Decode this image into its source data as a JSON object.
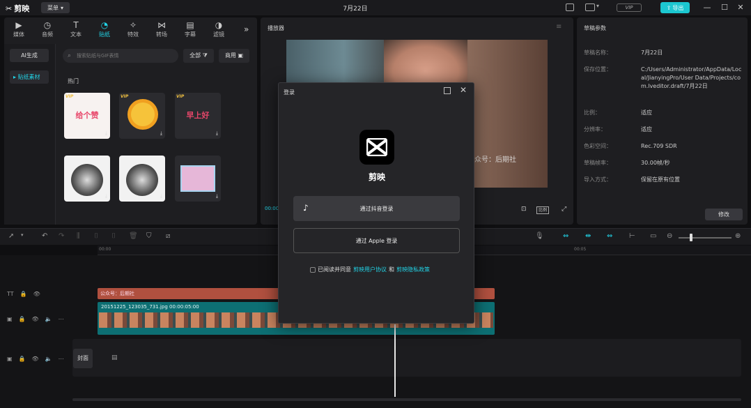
{
  "app": {
    "name": "剪映",
    "menu_label": "菜单",
    "title": "7月22日",
    "vip_label": "VIP",
    "export_label": "导出"
  },
  "tabs": [
    {
      "label": "媒体",
      "icon": "media-icon"
    },
    {
      "label": "音频",
      "icon": "audio-icon"
    },
    {
      "label": "文本",
      "icon": "text-icon"
    },
    {
      "label": "贴纸",
      "icon": "sticker-icon",
      "active": true
    },
    {
      "label": "特效",
      "icon": "effects-icon"
    },
    {
      "label": "转场",
      "icon": "transition-icon"
    },
    {
      "label": "字幕",
      "icon": "caption-icon"
    },
    {
      "label": "滤镜",
      "icon": "filter-icon"
    }
  ],
  "sticker_panel": {
    "ai_label": "AI生成",
    "category_label": "▸ 贴纸素材",
    "search_placeholder": "搜索贴纸与GIF表情",
    "filter_all": "全部",
    "filter_business": "商用",
    "section_title": "热门",
    "stickers": [
      {
        "text": "给个赞",
        "vip": "VIP"
      },
      {
        "text": "",
        "vip": "VIP"
      },
      {
        "text": "早上好",
        "vip": "VIP"
      },
      {
        "text": "",
        "vip": ""
      },
      {
        "text": "",
        "vip": ""
      },
      {
        "text": "",
        "vip": ""
      }
    ]
  },
  "player": {
    "title": "播放器",
    "watermark": "众号：后期社",
    "timecode": "00:00",
    "ratio_label": "比例"
  },
  "params": {
    "title": "草稿参数",
    "rows": [
      {
        "key": "草稿名称：",
        "value": "7月22日"
      },
      {
        "key": "保存位置：",
        "value": "C:/Users/Administrator/AppData/Local/JianyingPro/User Data/Projects/com.lveditor.draft/7月22日"
      },
      {
        "key": "比例：",
        "value": "适应"
      },
      {
        "key": "分辨率：",
        "value": "适应"
      },
      {
        "key": "色彩空间：",
        "value": "Rec.709 SDR"
      },
      {
        "key": "草稿帧率：",
        "value": "30.00帧/秒"
      },
      {
        "key": "导入方式：",
        "value": "保留在原有位置"
      }
    ],
    "modify_label": "修改"
  },
  "timeline": {
    "ruler_ticks": [
      "00:00",
      "00:05"
    ],
    "text_clip_label": "公众号：后期社",
    "video_clip_label": "20151225_123035_731.jpg   00:00:05:00",
    "cover_label": "封面"
  },
  "login_dialog": {
    "title": "登录",
    "app_name": "剪映",
    "douyin_btn": "通过抖音登录",
    "apple_btn": "通过 Apple 登录",
    "agree_prefix": "已阅读并同意",
    "agree_link1": "剪映用户协议",
    "agree_and": "和",
    "agree_link2": "剪映隐私政策"
  },
  "colors": {
    "accent": "#22d3e6",
    "text_clip": "#b0503f",
    "video_clip": "#0d6f73"
  }
}
